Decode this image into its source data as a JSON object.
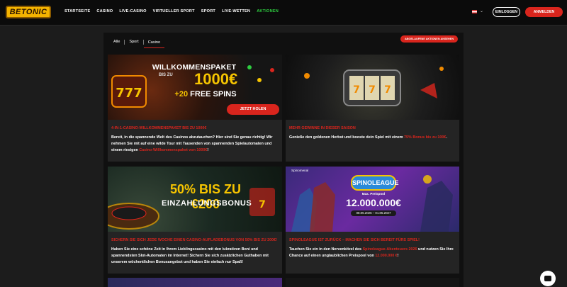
{
  "brand": {
    "logo_text": "BETONIC"
  },
  "nav": [
    {
      "label": "STARTSEITE",
      "active": false
    },
    {
      "label": "CASINO",
      "active": false
    },
    {
      "label": "LIVE-CASINO",
      "active": false
    },
    {
      "label": "VIRTUELLER SPORT",
      "active": false
    },
    {
      "label": "SPORT",
      "active": false
    },
    {
      "label": "LIVE-WETTEN",
      "active": false
    },
    {
      "label": "AKTIONEN",
      "active": true
    }
  ],
  "header": {
    "login_label": "EINLOGGEN",
    "register_label": "ANMELDEN",
    "caret": "⌄"
  },
  "filters": {
    "tabs": [
      "Alle",
      "Sport",
      "Casino"
    ],
    "active_index": 2,
    "expired_button": "ABGELAUFENE AKTIONEN ANSEHEN"
  },
  "cards": [
    {
      "banner": {
        "line1": "WILLKOMMENSPAKET",
        "sub": "BIS ZU",
        "amount": "1000€",
        "spins_prefix": "+20",
        "spins_label": "FREE SPINS",
        "cta": "JETZT HOLEN"
      },
      "title": "4-IN-1-CASINO-WILLKOMMENSPAKET BIS ZU 1000€",
      "desc_pre": "Bereit, in die spannende Welt des Casinos abzutauchen? Hier sind Sie genau richtig! Wir nehmen Sie mit auf eine wilde Tour mit Tausenden von spannenden Spielautomaten und einem riesigen ",
      "desc_hl": "Casino-Willkommenspaket von 1000€",
      "desc_post": "!"
    },
    {
      "title": "MEHR GEWINNE IN DIESER SAISON",
      "desc_pre": "Genieße den goldenen Herbst und booste dein Spiel mit einem ",
      "desc_hl": "75% Bonus bis zu 100€",
      "desc_post": "."
    },
    {
      "banner": {
        "line1": "50% BIS ZU €200",
        "line2": "EINZAHLUNGSBONUS"
      },
      "title": "SICHERN SIE SICH JEDE WOCHE EINEN CASINO-AUFLADEBONUS VON 50% BIS ZU 200€!",
      "desc_pre": "Haben Sie eine schöne Zeit in Ihrem Lieblingscasino mit den lukrativen Boni und spannendsten Slot-Automaten im Internet! Sichern Sie sich zusätzlichen Guthaben mit unserem wöchentlichen Bonusangebot und haben Sie einfach nur Spaß!",
      "desc_hl": "",
      "desc_post": ""
    },
    {
      "banner": {
        "brand": "Spinomenal",
        "logo": "SPINOLEAGUE",
        "sub": "Max. Preispool",
        "amount": "12.000.000€",
        "dates": "08.05.2026 – 01.05.2027"
      },
      "title": "SPINOLEAGUE IST ZURÜCK – MACHEN SIE SICH BEREIT FÜRS SPIEL!",
      "desc_pre": "Tauchen Sie ein in den Nervenkitzel des ",
      "desc_hl": "Spinoleague-Abenteuers 2026",
      "desc_mid": " und nutzen Sie Ihre Chance auf einen unglaublichen Preispool von ",
      "desc_hl2": "12.000.000 €",
      "desc_post": "!"
    }
  ]
}
